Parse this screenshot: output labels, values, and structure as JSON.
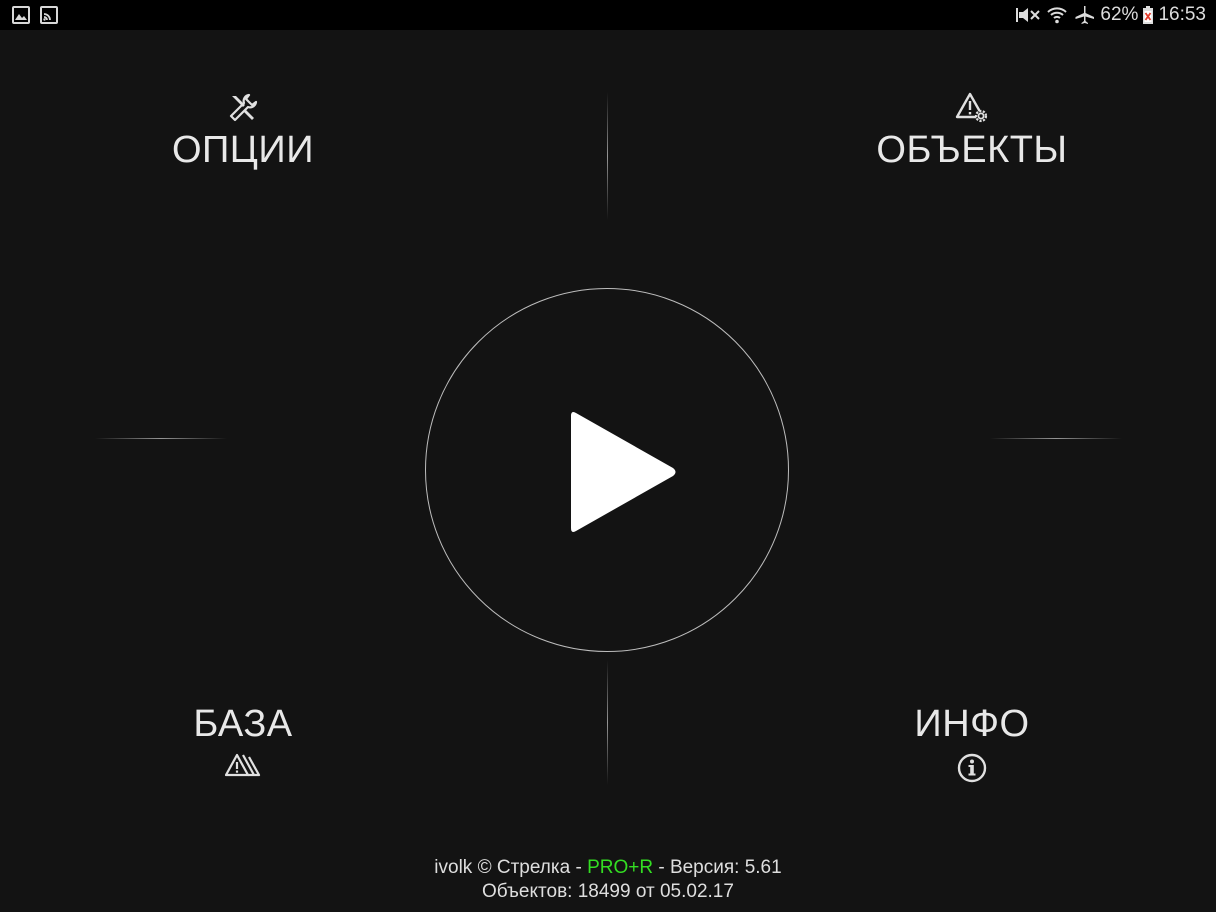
{
  "status_bar": {
    "left_icons": [
      "gallery-icon",
      "cast-icon"
    ],
    "right_icons": [
      "mute-icon",
      "wifi-icon",
      "airplane-icon"
    ],
    "battery_percent": "62%",
    "time": "16:53"
  },
  "menu": {
    "options": {
      "label": "ОПЦИИ",
      "icon": "tools-icon"
    },
    "objects": {
      "label": "ОБЪЕКТЫ",
      "icon": "warning-gear-icon"
    },
    "base": {
      "label": "БАЗА",
      "icon": "stacked-warning-icon"
    },
    "info": {
      "label": "ИНФО",
      "icon": "info-icon"
    }
  },
  "play": {
    "icon": "play-icon"
  },
  "footer": {
    "prefix": "ivolk © Стрелка - ",
    "edition": "PRO+R",
    "suffix": " - Версия: 5.61",
    "line2": "Объектов: 18499 от 05.02.17"
  },
  "colors": {
    "background": "#131313",
    "status_bar": "#000000",
    "edition_green": "#33dd22",
    "text": "#e8e8e8"
  }
}
